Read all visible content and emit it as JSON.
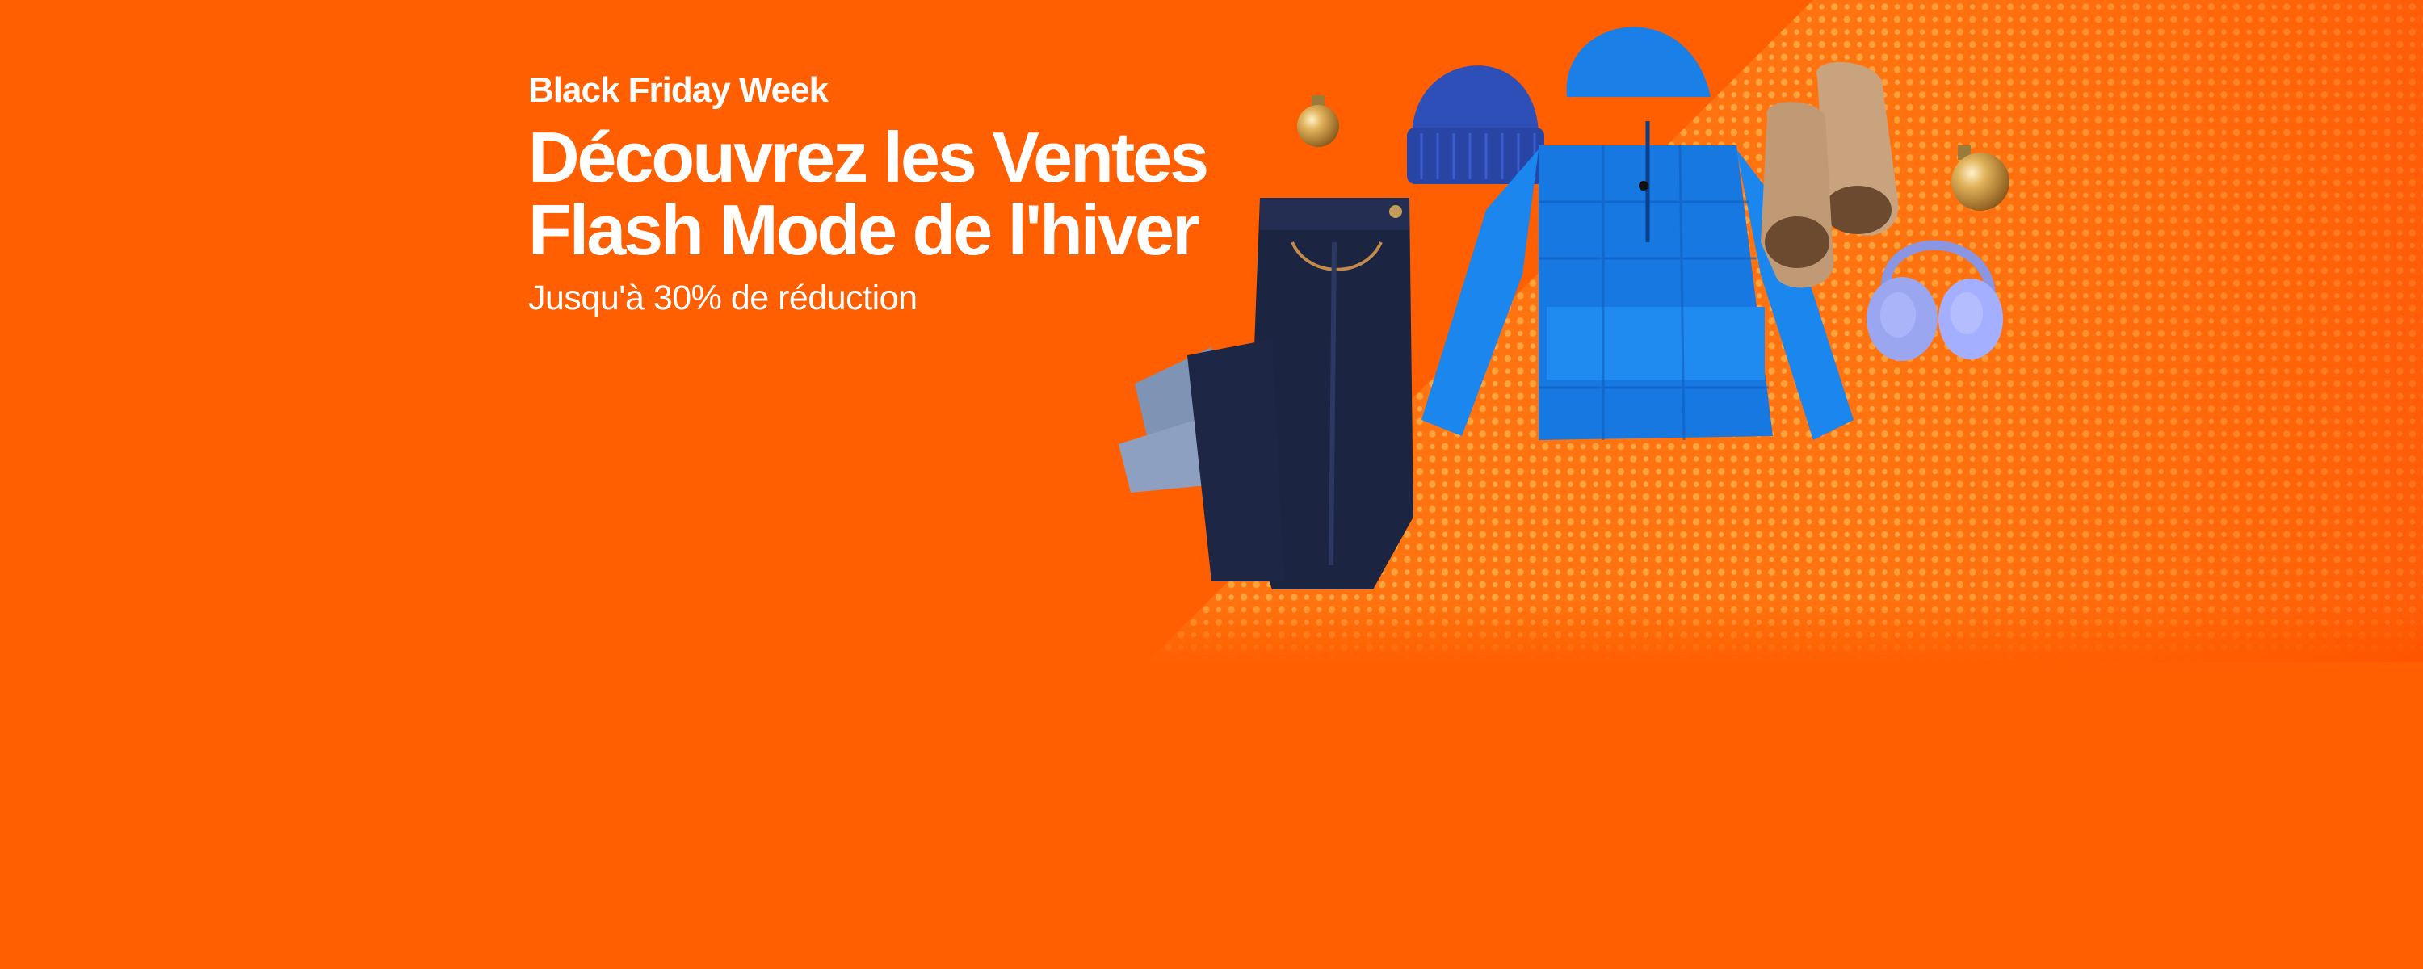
{
  "banner": {
    "eyebrow": "Black Friday Week",
    "headline_line1": "Découvrez les Ventes",
    "headline_line2": "Flash Mode de l'hiver",
    "subline": "Jusqu'à 30% de réduction"
  },
  "colors": {
    "background": "#ff5f00",
    "text": "#ffffff",
    "jacket": "#1a7fe6",
    "beanie": "#2d4fb8",
    "denim": "#1c2540",
    "boots": "#c9a37e",
    "earmuffs": "#9aa6f0",
    "ornament": "#c9963c"
  },
  "products": [
    {
      "name": "jeans",
      "icon": "jeans-image"
    },
    {
      "name": "beanie",
      "icon": "beanie-image"
    },
    {
      "name": "puffer-jacket",
      "icon": "jacket-image"
    },
    {
      "name": "boots",
      "icon": "boots-image"
    },
    {
      "name": "earmuffs",
      "icon": "earmuffs-image"
    },
    {
      "name": "ornaments",
      "icon": "ornament-image"
    }
  ]
}
